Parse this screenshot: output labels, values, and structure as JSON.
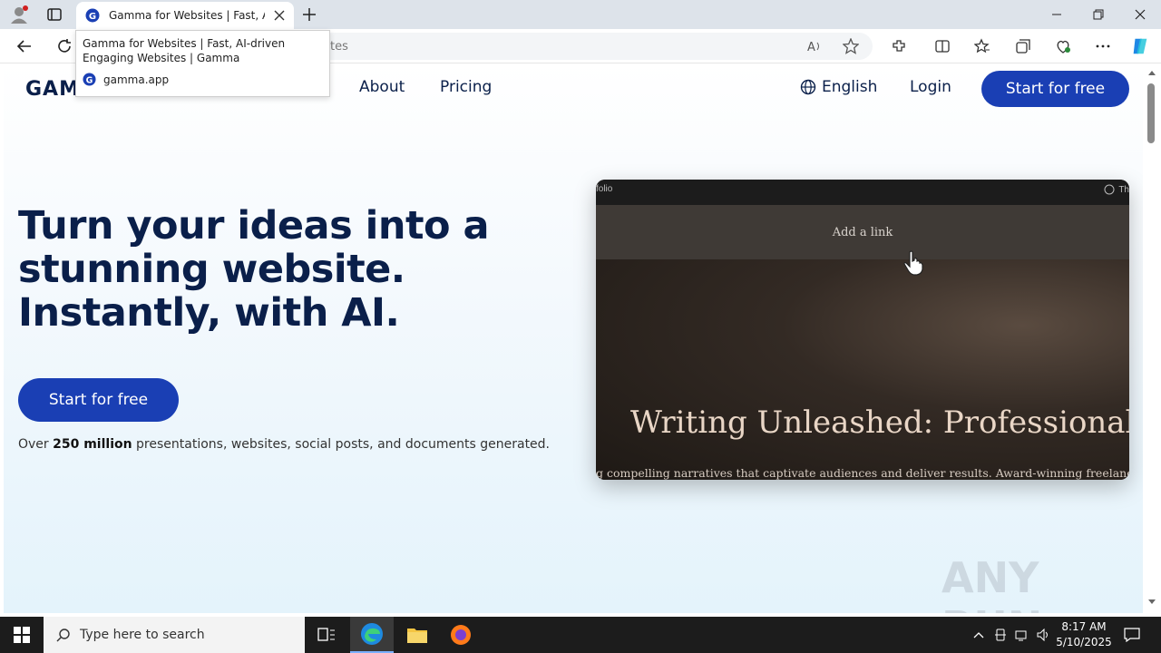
{
  "browser": {
    "tab": {
      "title": "Gamma for Websites | Fast, AI-driven Engaging Websites | Gamma"
    },
    "address": {
      "url_tail": "tes"
    },
    "tooltip": {
      "title": "Gamma for Websites | Fast, AI-driven Engaging Websites | Gamma",
      "domain": "gamma.app"
    }
  },
  "page": {
    "logo": "GAMMA",
    "nav": {
      "about": "About",
      "pricing": "Pricing",
      "language": "English",
      "login": "Login",
      "cta": "Start for free"
    },
    "headline": "Turn your ideas into a stunning website. Instantly, with AI.",
    "cta_main": "Start for free",
    "subtext_prefix": "Over ",
    "subtext_bold": "250 million",
    "subtext_suffix": " presentations, websites, social posts, and documents generated.",
    "preview": {
      "top_left": "folio",
      "top_right": "Th",
      "link_bar": "Add a link",
      "title": "Writing Unleashed: Professional Po",
      "subtitle": "g compelling narratives that captivate audiences and deliver results. Award-winning freelance"
    },
    "watermark": "ANY RUN"
  },
  "taskbar": {
    "search_placeholder": "Type here to search",
    "time": "8:17 AM",
    "date": "5/10/2025"
  }
}
